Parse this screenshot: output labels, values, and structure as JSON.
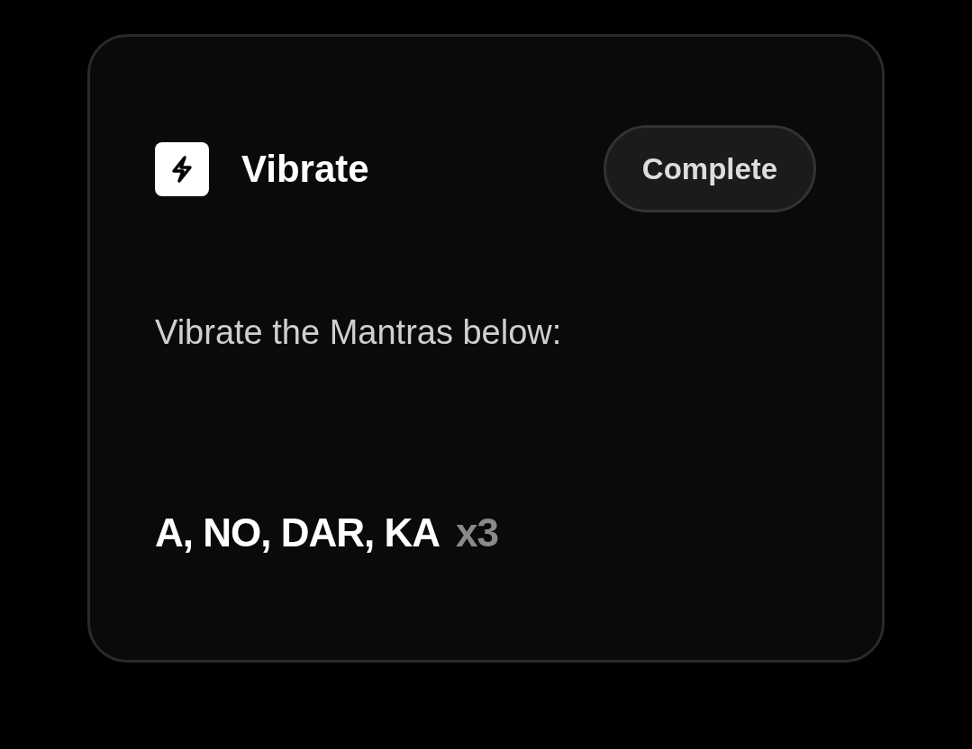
{
  "card": {
    "title": "Vibrate",
    "button": "Complete",
    "instruction": "Vibrate the Mantras below:",
    "mantra": "A, NO, DAR, KA",
    "repeat": "x3"
  }
}
